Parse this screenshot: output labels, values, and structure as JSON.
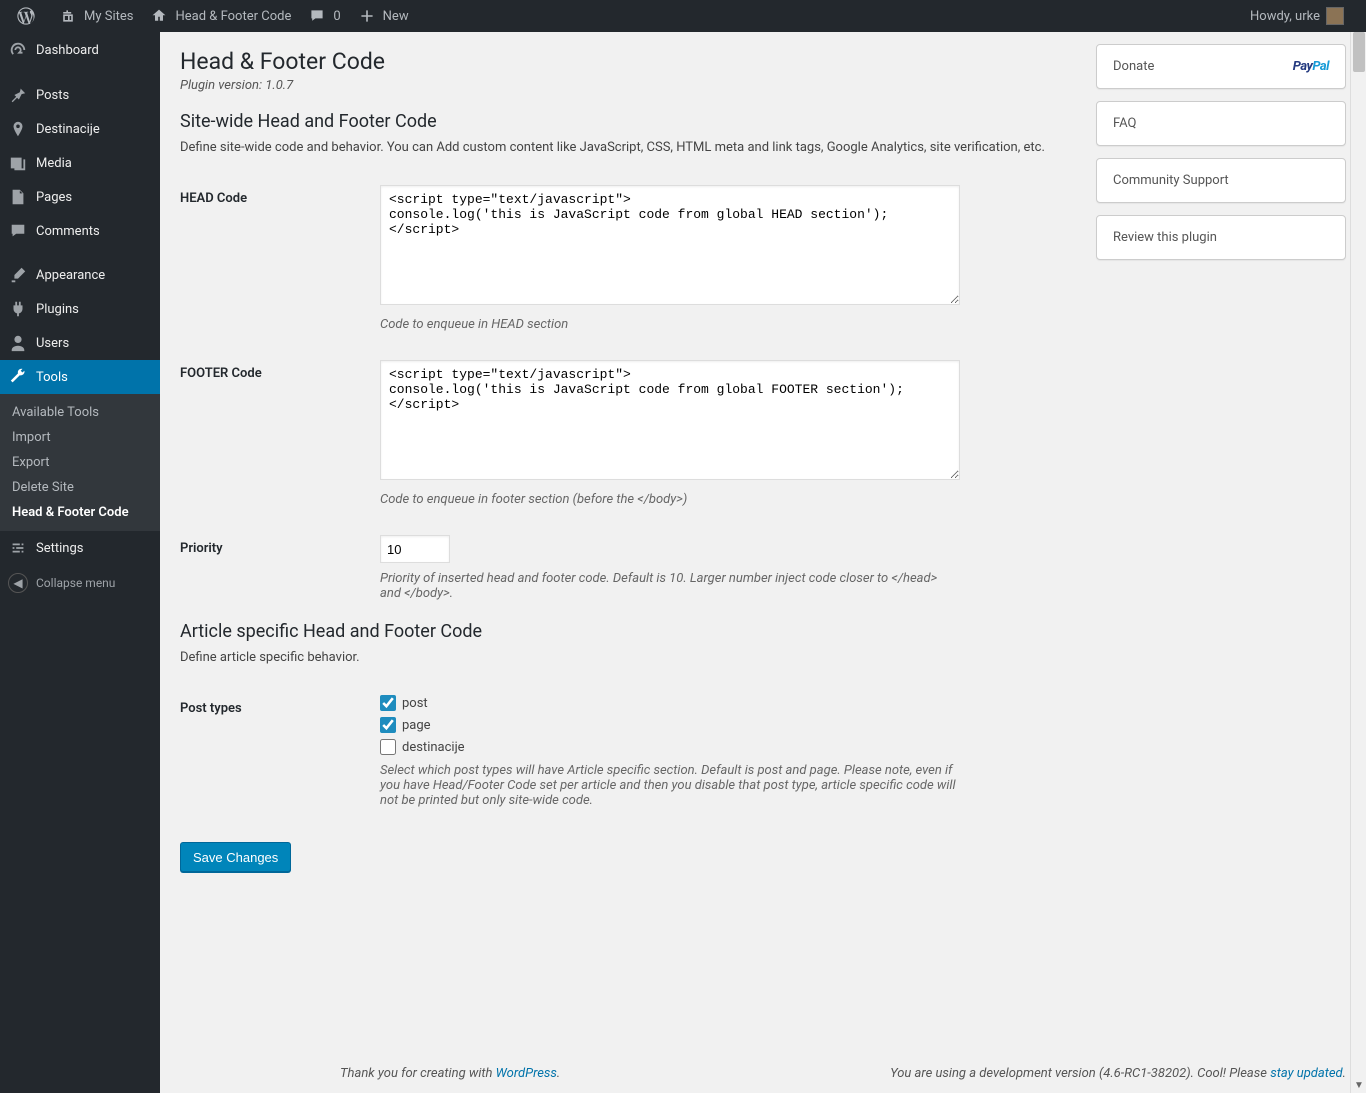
{
  "adminbar": {
    "my_sites": "My Sites",
    "site_name": "Head & Footer Code",
    "comments_count": "0",
    "new": "New",
    "howdy": "Howdy, urke"
  },
  "sidebar": {
    "dashboard": "Dashboard",
    "posts": "Posts",
    "destinacije": "Destinacije",
    "media": "Media",
    "pages": "Pages",
    "comments": "Comments",
    "appearance": "Appearance",
    "plugins": "Plugins",
    "users": "Users",
    "tools": "Tools",
    "tools_sub": {
      "available": "Available Tools",
      "import": "Import",
      "export": "Export",
      "delete_site": "Delete Site",
      "hfc": "Head & Footer Code"
    },
    "settings": "Settings",
    "collapse": "Collapse menu"
  },
  "page": {
    "title": "Head & Footer Code",
    "version": "Plugin version: 1.0.7",
    "section1_title": "Site-wide Head and Footer Code",
    "section1_desc": "Define site-wide code and behavior. You can Add custom content like JavaScript, CSS, HTML meta and link tags, Google Analytics, site verification, etc.",
    "head_label": "HEAD Code",
    "head_value": "<script type=\"text/javascript\">\nconsole.log('this is JavaScript code from global HEAD section');\n</script>",
    "head_help": "Code to enqueue in HEAD section",
    "footer_label": "FOOTER Code",
    "footer_value": "<script type=\"text/javascript\">\nconsole.log('this is JavaScript code from global FOOTER section');\n</script>",
    "footer_help": "Code to enqueue in footer section (before the </body>)",
    "priority_label": "Priority",
    "priority_value": "10",
    "priority_help": "Priority of inserted head and footer code. Default is 10. Larger number inject code closer to </head> and </body>.",
    "section2_title": "Article specific Head and Footer Code",
    "section2_desc": "Define article specific behavior.",
    "post_types_label": "Post types",
    "pt_post": "post",
    "pt_page": "page",
    "pt_dest": "destinacije",
    "pt_help": "Select which post types will have Article specific section. Default is post and page. Please note, even if you have Head/Footer Code set per article and then you disable that post type, article specific code will not be printed but only site-wide code.",
    "save": "Save Changes"
  },
  "side": {
    "donate": "Donate",
    "faq": "FAQ",
    "support": "Community Support",
    "review": "Review this plugin"
  },
  "footer": {
    "thanks_prefix": "Thank you for creating with ",
    "wp": "WordPress",
    "dev_prefix": "You are using a development version (4.6-RC1-38202). Cool! Please ",
    "stay": "stay updated"
  }
}
